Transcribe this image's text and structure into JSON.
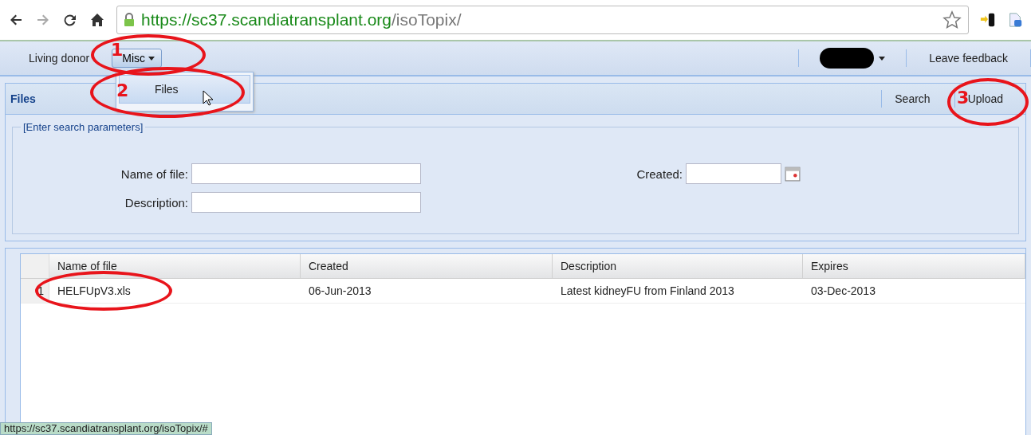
{
  "browser": {
    "url_host": "https://sc37.scandiatransplant.org",
    "url_path": "/isoTopix/"
  },
  "nav": {
    "items": [
      {
        "label": "Living donor",
        "kind": "link"
      },
      {
        "label": "Misc",
        "kind": "dropdown"
      }
    ],
    "right": [
      {
        "label": "Leave feedback"
      }
    ]
  },
  "menu": {
    "items": [
      {
        "label": "Files",
        "hovered": true
      }
    ]
  },
  "panel": {
    "title": "Files",
    "actions": [
      {
        "label": "Search"
      },
      {
        "label": "Upload"
      }
    ]
  },
  "search": {
    "legend": "[Enter search parameters]",
    "fields": [
      {
        "label": "Name of file:",
        "kind": "text"
      },
      {
        "label": "Description:",
        "kind": "text"
      }
    ],
    "created": {
      "label": "Created:",
      "kind": "date"
    }
  },
  "table": {
    "columns": [
      "Name of file",
      "Created",
      "Description",
      "Expires"
    ],
    "rows": [
      {
        "index": "1",
        "cells": [
          "HELFUpV3.xls",
          "06-Jun-2013",
          "Latest kidneyFU from Finland 2013",
          "03-Dec-2013"
        ]
      }
    ]
  },
  "annotations": [
    {
      "number": "1"
    },
    {
      "number": "2"
    },
    {
      "number": "3"
    }
  ],
  "status_bar": "https://sc37.scandiatransplant.org/isoTopix/#"
}
